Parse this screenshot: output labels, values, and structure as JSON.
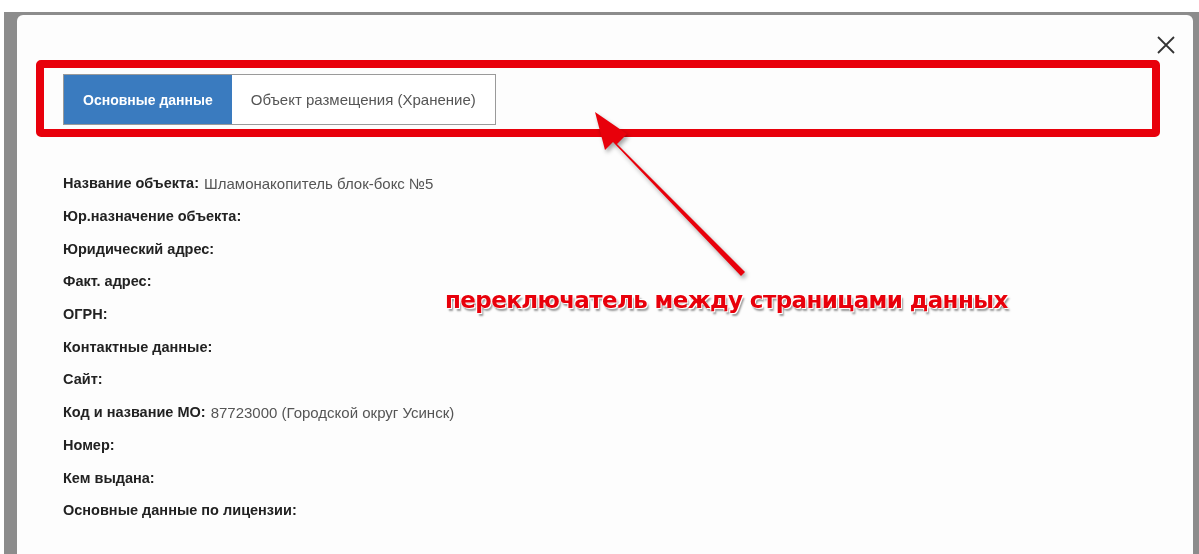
{
  "dialog": {
    "tabs": [
      {
        "label": "Основные данные",
        "selected": true
      },
      {
        "label": "Объект размещения (Хранение)",
        "selected": false
      }
    ],
    "fields": [
      {
        "label": "Название объекта:",
        "value": "Шламонакопитель блок-бокс №5"
      },
      {
        "label": "Юр.назначение объекта:"
      },
      {
        "label": "Юридический адрес:"
      },
      {
        "label": "Факт. адрес:"
      },
      {
        "label": "ОГРН:"
      },
      {
        "label": "Контактные данные:"
      },
      {
        "label": "Сайт:"
      },
      {
        "label": "Код и название МО:",
        "value": "87723000 (Городской округ Усинск)"
      },
      {
        "label": "Номер:"
      },
      {
        "label": "Кем выдана:"
      },
      {
        "label": "Основные данные по лицензии:"
      }
    ]
  },
  "annotation": {
    "text": "переключатель между страницами данных"
  }
}
